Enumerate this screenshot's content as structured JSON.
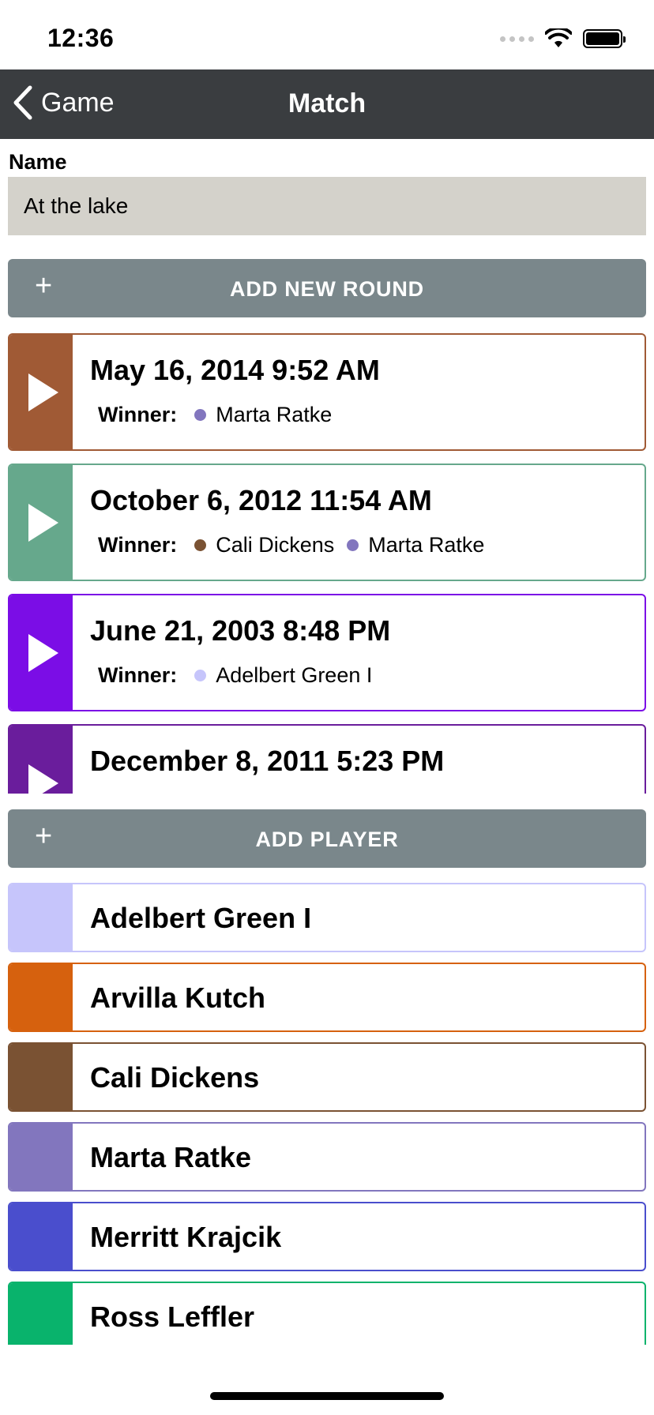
{
  "status_bar": {
    "time": "12:36",
    "icons": [
      "signal-icon",
      "wifi-icon",
      "battery-icon"
    ]
  },
  "nav": {
    "back_label": "Game",
    "title": "Match"
  },
  "name": {
    "label": "Name",
    "value": "At the lake"
  },
  "add_round": {
    "icon": "+",
    "label": "ADD NEW ROUND"
  },
  "rounds": [
    {
      "date": "May 16, 2014 9:52 AM",
      "color": "#a05a35",
      "winner_label": "Winner:",
      "winners": [
        {
          "name": "Marta Ratke",
          "color": "#8276be"
        }
      ]
    },
    {
      "date": "October 6, 2012 11:54 AM",
      "color": "#66a88c",
      "winner_label": "Winner:",
      "winners": [
        {
          "name": "Cali Dickens",
          "color": "#7a5233"
        },
        {
          "name": "Marta Ratke",
          "color": "#8276be"
        }
      ]
    },
    {
      "date": "June 21, 2003 8:48 PM",
      "color": "#7b0de6",
      "winner_label": "Winner:",
      "winners": [
        {
          "name": "Adelbert Green I",
          "color": "#c6c5fb"
        }
      ]
    },
    {
      "date": "December 8, 2011 5:23 PM",
      "color": "#6a1d9c",
      "winner_label": "",
      "winners": []
    }
  ],
  "add_player": {
    "icon": "+",
    "label": "ADD PLAYER"
  },
  "players": [
    {
      "name": "Adelbert Green I",
      "color": "#c6c5fb"
    },
    {
      "name": "Arvilla Kutch",
      "color": "#d6610e"
    },
    {
      "name": "Cali Dickens",
      "color": "#7a5233"
    },
    {
      "name": "Marta Ratke",
      "color": "#8276be"
    },
    {
      "name": "Merritt Krajcik",
      "color": "#4a4ecd"
    },
    {
      "name": "Ross Leffler",
      "color": "#09b36c"
    }
  ]
}
